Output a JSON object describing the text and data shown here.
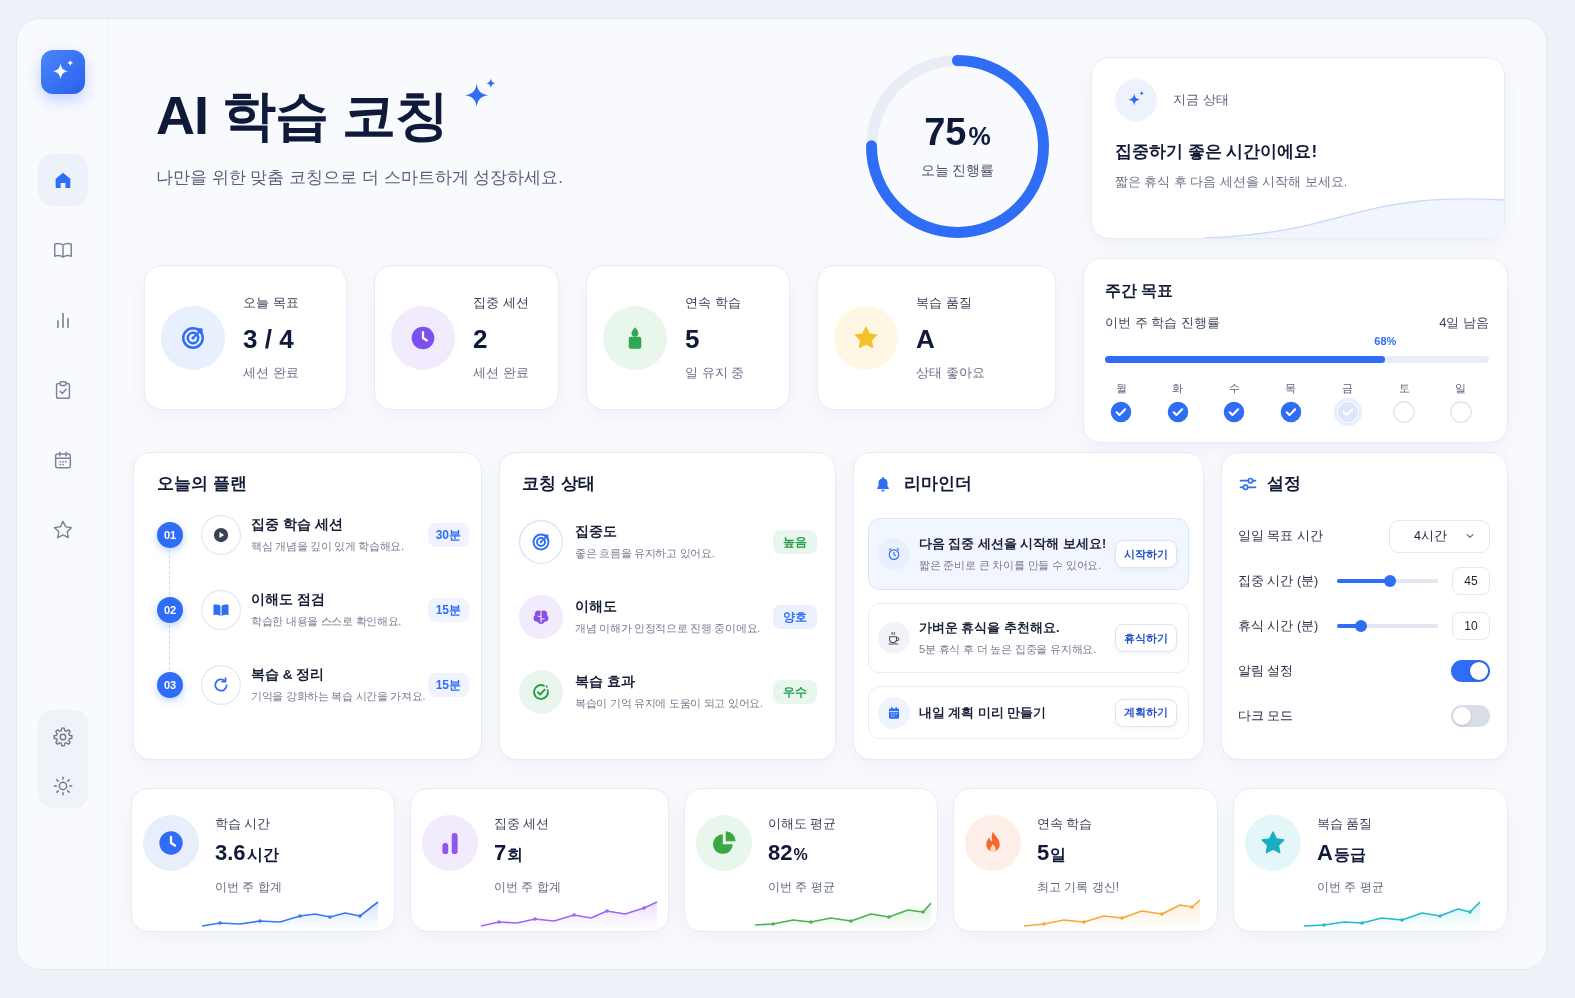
{
  "sidebar": {
    "items": [
      {
        "kind": "home",
        "selected": true
      },
      {
        "kind": "book",
        "selected": false
      },
      {
        "kind": "chart",
        "selected": false
      },
      {
        "kind": "clipboard",
        "selected": false
      },
      {
        "kind": "calendar",
        "selected": false
      },
      {
        "kind": "star",
        "selected": false
      }
    ],
    "footer_items": [
      {
        "kind": "settings"
      },
      {
        "kind": "theme"
      }
    ]
  },
  "header": {
    "title": "AI 학습 코칭",
    "subtitle": "나만을 위한 맞춤 코칭으로 더 스마트하게 성장하세요."
  },
  "daily_progress": {
    "value": "75",
    "unit": "%",
    "label": "오늘 진행률",
    "level": 0.75
  },
  "current_status": {
    "label": "지금 상태",
    "title": "집중하기 좋은 시간이에요!",
    "text": "짧은 휴식 후 다음 세션을 시작해 보세요."
  },
  "stats": [
    {
      "kind": "target",
      "label": "오늘 목표",
      "value": "3 / 4",
      "caption": "세션 완료"
    },
    {
      "kind": "clock",
      "label": "집중 세션",
      "value": "2",
      "caption": "세션 완료"
    },
    {
      "kind": "candle",
      "label": "연속 학습",
      "value": "5",
      "caption": "일 유지 중"
    },
    {
      "kind": "star",
      "label": "복습 품질",
      "value": "A",
      "caption": "상태 좋아요"
    }
  ],
  "weekly_goal": {
    "title": "주간 목표",
    "label": "이번 주 학습 진행률",
    "remaining": "4일 남음",
    "percent": "68%",
    "level": 0.73,
    "days": [
      {
        "label": "월",
        "checked": true,
        "in_progress": false
      },
      {
        "label": "화",
        "checked": true,
        "in_progress": false
      },
      {
        "label": "수",
        "checked": true,
        "in_progress": false
      },
      {
        "label": "목",
        "checked": true,
        "in_progress": false
      },
      {
        "label": "금",
        "checked": false,
        "in_progress": true
      },
      {
        "label": "토",
        "checked": false,
        "in_progress": false
      },
      {
        "label": "일",
        "checked": false,
        "in_progress": false
      }
    ]
  },
  "todays_plan": {
    "title": "오늘의 플랜",
    "items": [
      {
        "number": "01",
        "kind": "play",
        "title": "집중 학습 세션",
        "text": "핵심 개념을 깊이 있게 학습해요.",
        "duration": "30분"
      },
      {
        "number": "02",
        "kind": "book",
        "title": "이해도 점검",
        "text": "학습한 내용을 스스로 확인해요.",
        "duration": "15분"
      },
      {
        "number": "03",
        "kind": "refresh",
        "title": "복습 & 정리",
        "text": "기억을 강화하는 복습 시간을 가져요.",
        "duration": "15분"
      }
    ]
  },
  "coaching_status": {
    "title": "코칭 상태",
    "items": [
      {
        "kind": "target",
        "title": "집중도",
        "text": "좋은 흐름을 유지하고 있어요.",
        "badge": "높음",
        "color": "#23a04f"
      },
      {
        "kind": "brain",
        "title": "이해도",
        "text": "개념 이해가 안정적으로 진행 중이에요.",
        "badge": "양호",
        "color": "#2f6df6"
      },
      {
        "kind": "check",
        "title": "복습 효과",
        "text": "복습이 기억 유지에 도움이 되고 있어요.",
        "badge": "우수",
        "color": "#23a04f"
      }
    ]
  },
  "reminders": {
    "title": "리마인더",
    "items": [
      {
        "kind": "alarm",
        "title": "다음 집중 세션을 시작해 보세요!",
        "text": "짧은 준비로 큰 차이를 만들 수 있어요.",
        "action": "시작하기",
        "highlighted": true
      },
      {
        "kind": "cup",
        "title": "가벼운 휴식을 추천해요.",
        "text": "5분 휴식 후 더 높은 집중을 유지해요.",
        "action": "휴식하기",
        "highlighted": false
      },
      {
        "kind": "calendar",
        "title": "내일 계획 미리 만들기",
        "action": "계획하기",
        "highlighted": false
      }
    ]
  },
  "settings": {
    "title": "설정",
    "rows": [
      {
        "kind": "select",
        "label": "일일 목표 시간",
        "value": "4시간"
      },
      {
        "kind": "slider",
        "label": "집중 시간 (분)",
        "level": 0.52,
        "value": "45"
      },
      {
        "kind": "slider",
        "label": "휴식 시간 (분)",
        "level": 0.24,
        "value": "10"
      },
      {
        "kind": "toggle",
        "label": "알림 설정",
        "on": true
      },
      {
        "kind": "toggle",
        "label": "다크 모드",
        "on": false
      }
    ]
  },
  "weekly_metrics": [
    {
      "kind": "clock",
      "label": "학습 시간",
      "value": "3.6",
      "unit": "시간",
      "caption": "이번 주 합계"
    },
    {
      "kind": "bars",
      "label": "집중 세션",
      "value": "7",
      "unit": "회",
      "caption": "이번 주 합계"
    },
    {
      "kind": "pie",
      "label": "이해도 평균",
      "value": "82",
      "unit": "%",
      "caption": "이번 주 평균"
    },
    {
      "kind": "flame",
      "label": "연속 학습",
      "value": "5",
      "unit": "일",
      "caption": "최고 기록 갱신!"
    },
    {
      "kind": "star",
      "label": "복습 품질",
      "value": "A",
      "unit": "등급",
      "caption": "이번 주 평균"
    }
  ]
}
